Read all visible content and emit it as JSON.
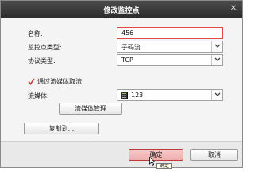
{
  "dialog": {
    "title": "修改监控点",
    "close_glyph": "✕"
  },
  "form": {
    "name_label": "名称:",
    "name_value": "456",
    "type_label": "监控点类型:",
    "type_value": "子码流",
    "protocol_label": "协议类型:",
    "protocol_value": "TCP",
    "via_stream_label": "通过流媒体取流",
    "via_stream_checked": true,
    "stream_label": "流媒体:",
    "stream_value": "123",
    "stream_icon": "server-icon"
  },
  "buttons": {
    "stream_manage": "流媒体管理",
    "copy_to": "复制到...",
    "ok": "确定",
    "cancel": "取消"
  },
  "tooltip": {
    "text": "确定"
  },
  "colors": {
    "title_bar": "#333333",
    "focus_border": "#e24848",
    "check_mark": "#d23a3a",
    "primary_button": "#efadad"
  }
}
